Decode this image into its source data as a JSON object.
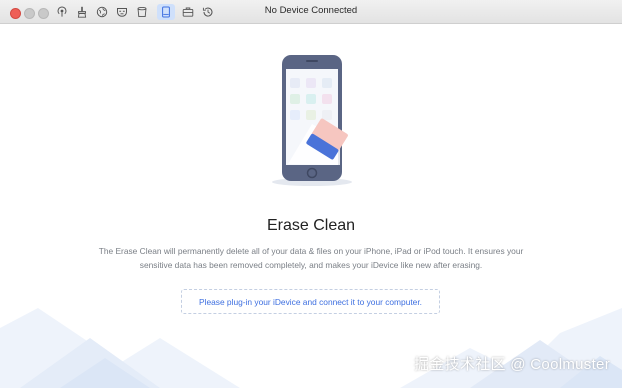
{
  "window": {
    "title": "No Device Connected"
  },
  "toolbar": {
    "icons": [
      "podcast-icon",
      "broom-icon",
      "globe-icon",
      "mask-icon",
      "trash-icon",
      "tablet-icon",
      "briefcase-icon",
      "history-icon"
    ],
    "active_icon": "tablet-icon"
  },
  "main": {
    "heading": "Erase Clean",
    "description": "The Erase Clean will permanently delete all of your data & files on your iPhone, iPad or iPod touch. It ensures your sensitive data has been removed completely, and makes your iDevice like new after erasing.",
    "plug_prompt": "Please plug-in your iDevice and connect it to your computer."
  },
  "watermark": "掘金技术社区 @ Coolmuster",
  "colors": {
    "accent": "#3d6fe0",
    "phone_body": "#5a6584",
    "eraser_blue": "#4a73d9",
    "eraser_pink": "#f6c6c0",
    "mountain": "#e6eefa"
  }
}
